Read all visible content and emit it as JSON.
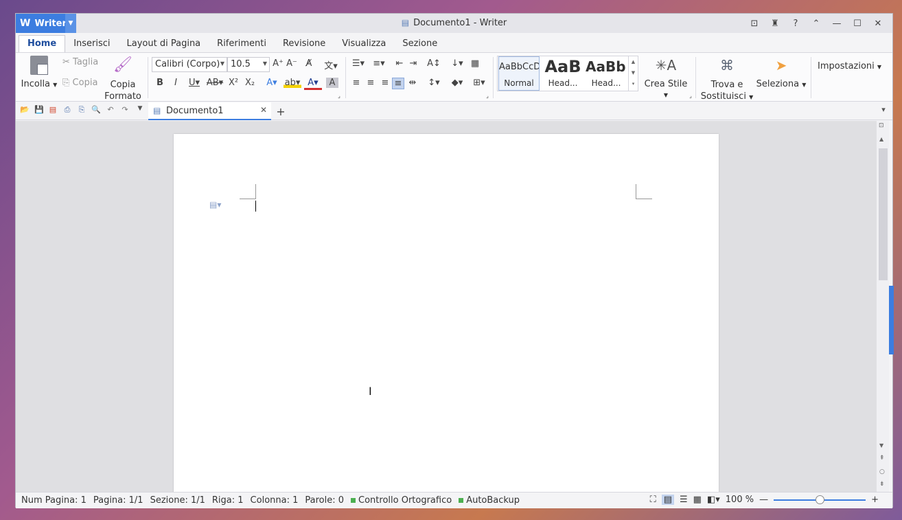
{
  "window": {
    "app_name": "Writer",
    "title": "Documento1 - Writer"
  },
  "menu": {
    "tabs": [
      "Home",
      "Inserisci",
      "Layout di Pagina",
      "Riferimenti",
      "Revisione",
      "Visualizza",
      "Sezione"
    ],
    "active": "Home"
  },
  "ribbon": {
    "paste": "Incolla",
    "cut": "Taglia",
    "copy": "Copia",
    "format_painter_1": "Copia",
    "format_painter_2": "Formato",
    "font_name": "Calibri (Corpo)",
    "font_size": "10.5",
    "styles": [
      {
        "preview": "AaBbCcD",
        "label": "Normal"
      },
      {
        "preview": "AaB",
        "label": "Head..."
      },
      {
        "preview": "AaBb(",
        "label": "Head..."
      }
    ],
    "create_style": "Crea Stile",
    "find_replace_1": "Trova e",
    "find_replace_2": "Sostituisci",
    "select": "Seleziona",
    "settings": "Impostazioni"
  },
  "document_tab": {
    "name": "Documento1"
  },
  "status": {
    "num_pagina": "Num Pagina: 1",
    "pagina": "Pagina: 1/1",
    "sezione": "Sezione: 1/1",
    "riga": "Riga: 1",
    "colonna": "Colonna: 1",
    "parole": "Parole: 0",
    "spell": "Controllo Ortografico",
    "backup": "AutoBackup",
    "zoom": "100 %",
    "zoom_fraction": 0.5
  },
  "colors": {
    "accent": "#3c7de0",
    "active_tab_text": "#1f4e9e"
  }
}
